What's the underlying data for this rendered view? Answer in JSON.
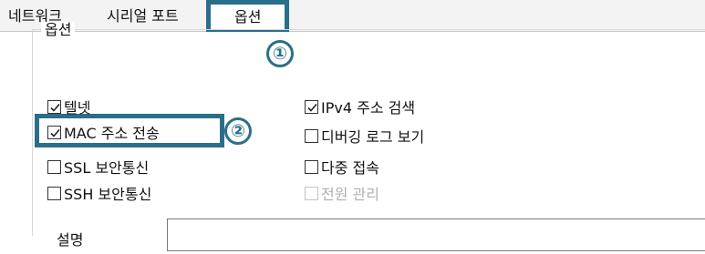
{
  "tabs": [
    {
      "label": "네트워크"
    },
    {
      "label": "시리얼 포트"
    },
    {
      "label": "옵션"
    }
  ],
  "callouts": {
    "one": "①",
    "two": "②"
  },
  "group": {
    "title": "옵션"
  },
  "options_left": [
    {
      "label": "텔넷",
      "checked": true
    },
    {
      "label": "MAC 주소 전송",
      "checked": true
    },
    {
      "label": "SSL 보안통신",
      "checked": false
    },
    {
      "label": "SSH 보안통신",
      "checked": false
    }
  ],
  "options_right": [
    {
      "label": "IPv4 주소 검색",
      "checked": true
    },
    {
      "label": "디버깅 로그 보기",
      "checked": false
    },
    {
      "label": "다중 접속",
      "checked": false
    },
    {
      "label": "전원 관리",
      "checked": false,
      "disabled": true
    }
  ],
  "description": {
    "label": "설명",
    "value": ""
  },
  "colors": {
    "highlight": "#2a6f8a"
  }
}
